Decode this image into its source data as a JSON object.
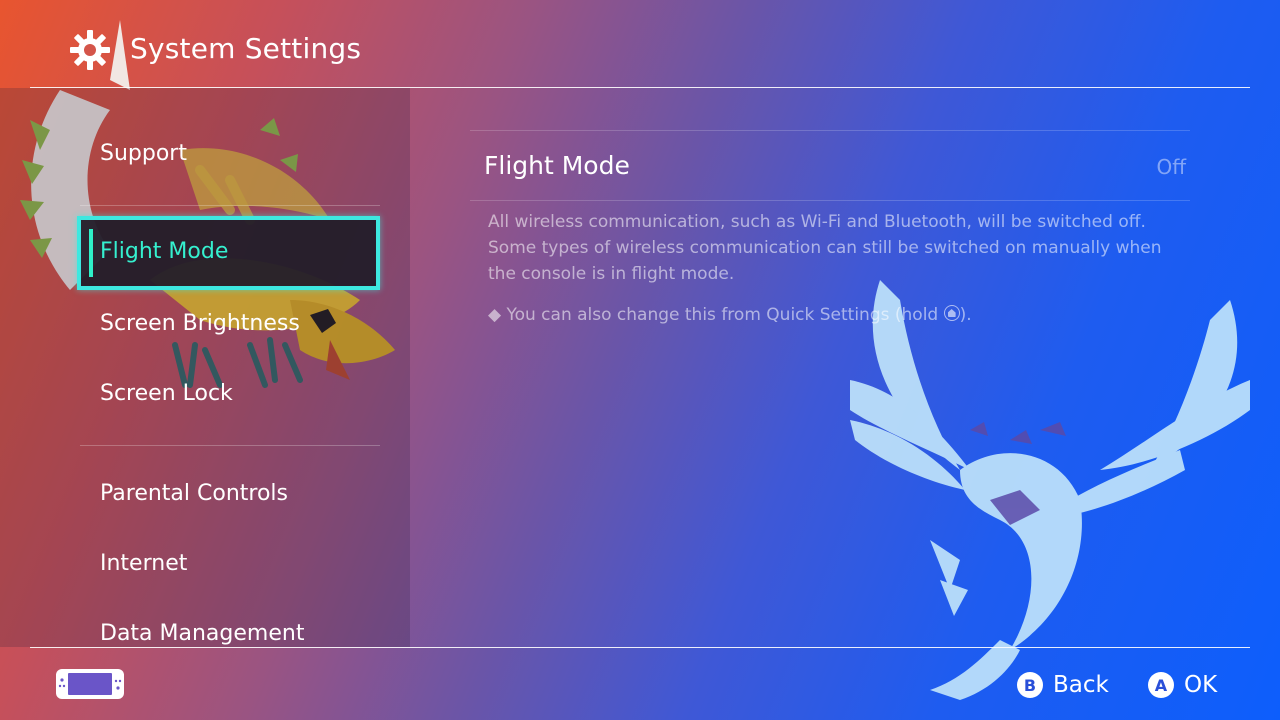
{
  "header": {
    "title": "System Settings",
    "icon": "gear-icon"
  },
  "sidebar": {
    "items": [
      {
        "label": "Support"
      },
      {
        "label": "Flight Mode",
        "selected": true
      },
      {
        "label": "Screen Brightness"
      },
      {
        "label": "Screen Lock"
      },
      {
        "label": "Parental Controls"
      },
      {
        "label": "Internet"
      },
      {
        "label": "Data Management"
      }
    ]
  },
  "content": {
    "setting_title": "Flight Mode",
    "setting_value": "Off",
    "description": "All wireless communication, such as Wi-Fi and Bluetooth, will be switched off. Some types of wireless communication can still be switched on manually when the console is in flight mode.",
    "note": "◆ You can also change this from Quick Settings (hold",
    "note_end": ")."
  },
  "footer": {
    "back": {
      "key": "B",
      "label": "Back"
    },
    "ok": {
      "key": "A",
      "label": "OK"
    }
  },
  "colors": {
    "accent_border": "#3ee8e0",
    "accent_text": "#35f0cf"
  }
}
